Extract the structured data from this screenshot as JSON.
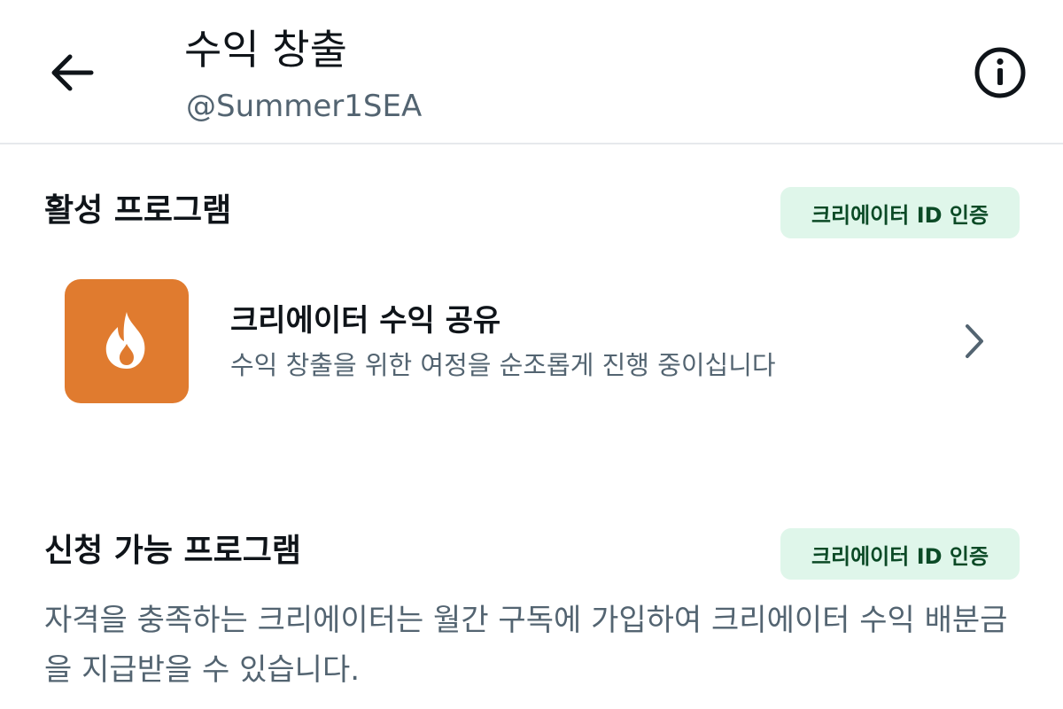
{
  "header": {
    "title": "수익 창출",
    "handle": "@Summer1SEA"
  },
  "active_programs": {
    "title": "활성 프로그램",
    "badge": "크리에이터 ID 인증",
    "items": [
      {
        "title": "크리에이터 수익 공유",
        "description": "수익 창출을 위한 여정을 순조롭게 진행 중이십니다",
        "icon": "flame-icon",
        "icon_bg": "#e07b2f"
      }
    ]
  },
  "available_programs": {
    "title": "신청 가능 프로그램",
    "badge": "크리에이터 ID 인증",
    "description": "자격을 충족하는 크리에이터는 월간 구독에 가입하여 크리에이터 수익 배분금을 지급받을 수 있습니다."
  },
  "colors": {
    "badge_bg": "#dff6ea",
    "badge_text": "#0b4a26",
    "secondary_text": "#536471",
    "divider": "#e6e9ec"
  }
}
